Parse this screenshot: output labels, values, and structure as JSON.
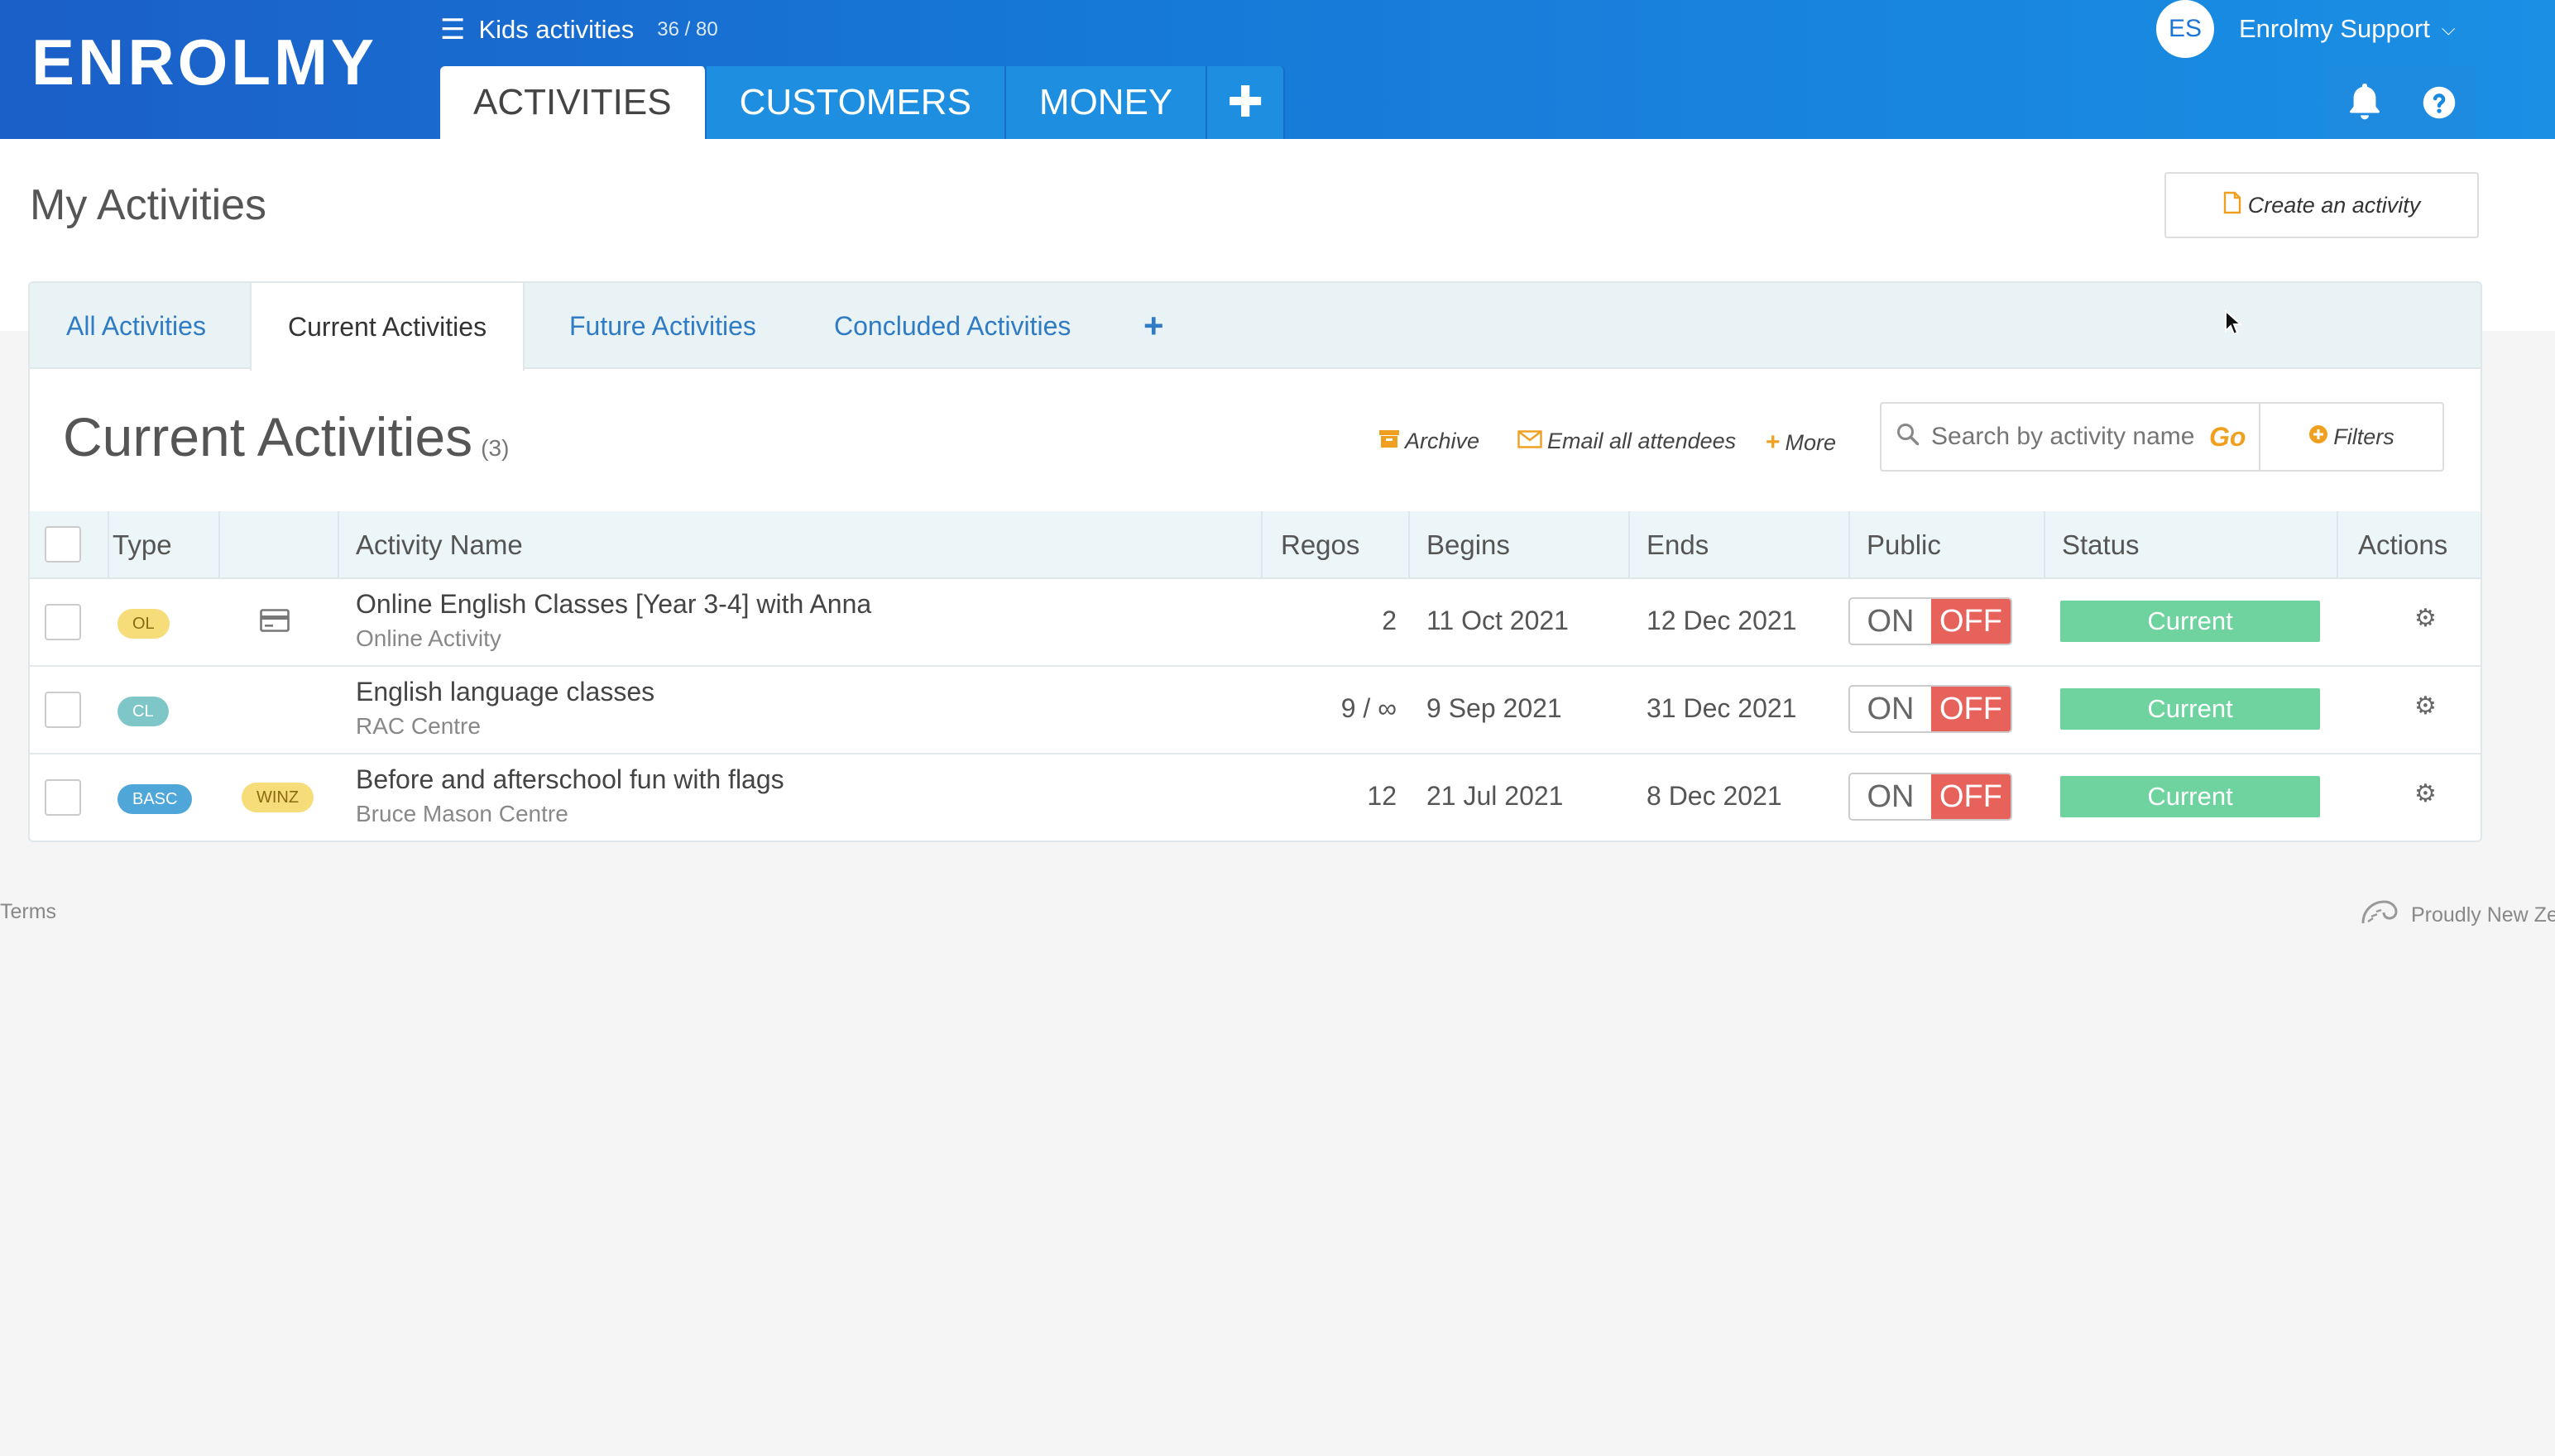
{
  "header": {
    "logo": "ENROLMY",
    "org_name": "Kids activities",
    "org_count": "36 / 80",
    "tabs": [
      {
        "label": "ACTIVITIES"
      },
      {
        "label": "CUSTOMERS"
      },
      {
        "label": "MONEY"
      }
    ],
    "add_tab_label": "✚",
    "user": {
      "initials": "ES",
      "name": "Enrolmy Support"
    }
  },
  "page": {
    "title": "My Activities",
    "create_button": "Create an activity"
  },
  "subtabs": [
    {
      "label": "All Activities"
    },
    {
      "label": "Current Activities"
    },
    {
      "label": "Future Activities"
    },
    {
      "label": "Concluded Activities"
    }
  ],
  "section": {
    "title": "Current Activities",
    "count": "(3)",
    "actions": {
      "archive": "Archive",
      "email": "Email all attendees",
      "more": "More"
    },
    "search_placeholder": "Search by activity name",
    "go_label": "Go",
    "filters_label": "Filters"
  },
  "table": {
    "headers": {
      "type": "Type",
      "name": "Activity Name",
      "regos": "Regos",
      "begins": "Begins",
      "ends": "Ends",
      "public": "Public",
      "status": "Status",
      "actions": "Actions"
    },
    "rows": [
      {
        "type": "OL",
        "extra": "",
        "name": "Online English Classes [Year 3-4] with Anna",
        "location": "Online Activity",
        "regos": "2",
        "begins": "11 Oct 2021",
        "ends": "12 Dec 2021",
        "on": "ON",
        "off": "OFF",
        "status": "Current"
      },
      {
        "type": "CL",
        "extra": "",
        "name": "English language classes",
        "location": "RAC Centre",
        "regos": "9 / ∞",
        "begins": "9 Sep 2021",
        "ends": "31 Dec 2021",
        "on": "ON",
        "off": "OFF",
        "status": "Current"
      },
      {
        "type": "BASC",
        "extra": "WINZ",
        "name": "Before and afterschool fun with flags",
        "location": "Bruce Mason Centre",
        "regos": "12",
        "begins": "21 Jul 2021",
        "ends": "8 Dec 2021",
        "on": "ON",
        "off": "OFF",
        "status": "Current"
      }
    ]
  },
  "footer": {
    "terms": "Terms",
    "tagline": "Proudly New Ze"
  },
  "colors": {
    "brand_blue": "#1677d6",
    "accent_orange": "#f0a020",
    "status_green": "#6fd3a0",
    "toggle_off_red": "#e8625c",
    "badge_ol": "#f6dd7a",
    "badge_cl": "#7fc6c9",
    "badge_basc": "#4fa6d9",
    "badge_winz": "#f6dd7a"
  },
  "icons": [
    "menu-icon",
    "plus-icon",
    "bell-icon",
    "question-icon",
    "document-icon",
    "archive-icon",
    "envelope-icon",
    "search-icon",
    "plus-circle-icon",
    "credit-card-icon",
    "gear-icon",
    "fern-icon",
    "cursor-icon",
    "chevron-down-icon"
  ]
}
